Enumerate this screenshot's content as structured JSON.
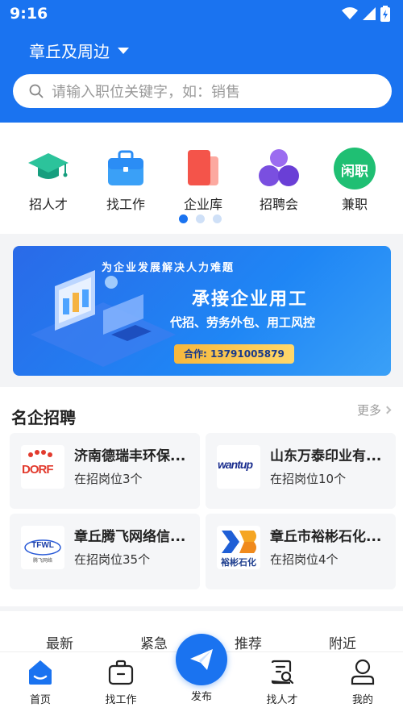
{
  "status": {
    "time": "9:16"
  },
  "header": {
    "location": "章丘及周边"
  },
  "search": {
    "placeholder": "请输入职位关键字，如：销售"
  },
  "quick_menu": [
    {
      "label": "招人才",
      "icon": "graduation-cap-icon"
    },
    {
      "label": "找工作",
      "icon": "briefcase-icon"
    },
    {
      "label": "企业库",
      "icon": "documents-icon"
    },
    {
      "label": "招聘会",
      "icon": "group-icon"
    },
    {
      "label": "兼职",
      "icon": "part-time-badge-icon",
      "badge": "闲职"
    }
  ],
  "carousel": {
    "pages": 3,
    "active": 1
  },
  "banner": {
    "top": "为企业发展解决人力难题",
    "title": "承接企业用工",
    "subtitle": "代招、劳务外包、用工风控",
    "contact": "合作: 13791005879"
  },
  "companies_section": {
    "title": "名企招聘",
    "more": "更多",
    "items": [
      {
        "name": "济南德瑞丰环保...",
        "count": "在招岗位3个",
        "logo_text": "DORF"
      },
      {
        "name": "山东万泰印业有...",
        "count": "在招岗位10个",
        "logo_text": "wantup"
      },
      {
        "name": "章丘腾飞网络信...",
        "count": "在招岗位35个",
        "logo_text": "TFWL",
        "logo_sub": "腾飞网络"
      },
      {
        "name": "章丘市裕彬石化...",
        "count": "在招岗位4个",
        "logo_text": "裕彬石化"
      }
    ]
  },
  "tabs": [
    "最新",
    "紧急",
    "推荐",
    "附近"
  ],
  "nav": [
    {
      "label": "首页"
    },
    {
      "label": "找工作"
    },
    {
      "label": "发布"
    },
    {
      "label": "找人才"
    },
    {
      "label": "我的"
    }
  ],
  "colors": {
    "brand": "#1a73f0",
    "active_dot": "#1a73f0"
  }
}
